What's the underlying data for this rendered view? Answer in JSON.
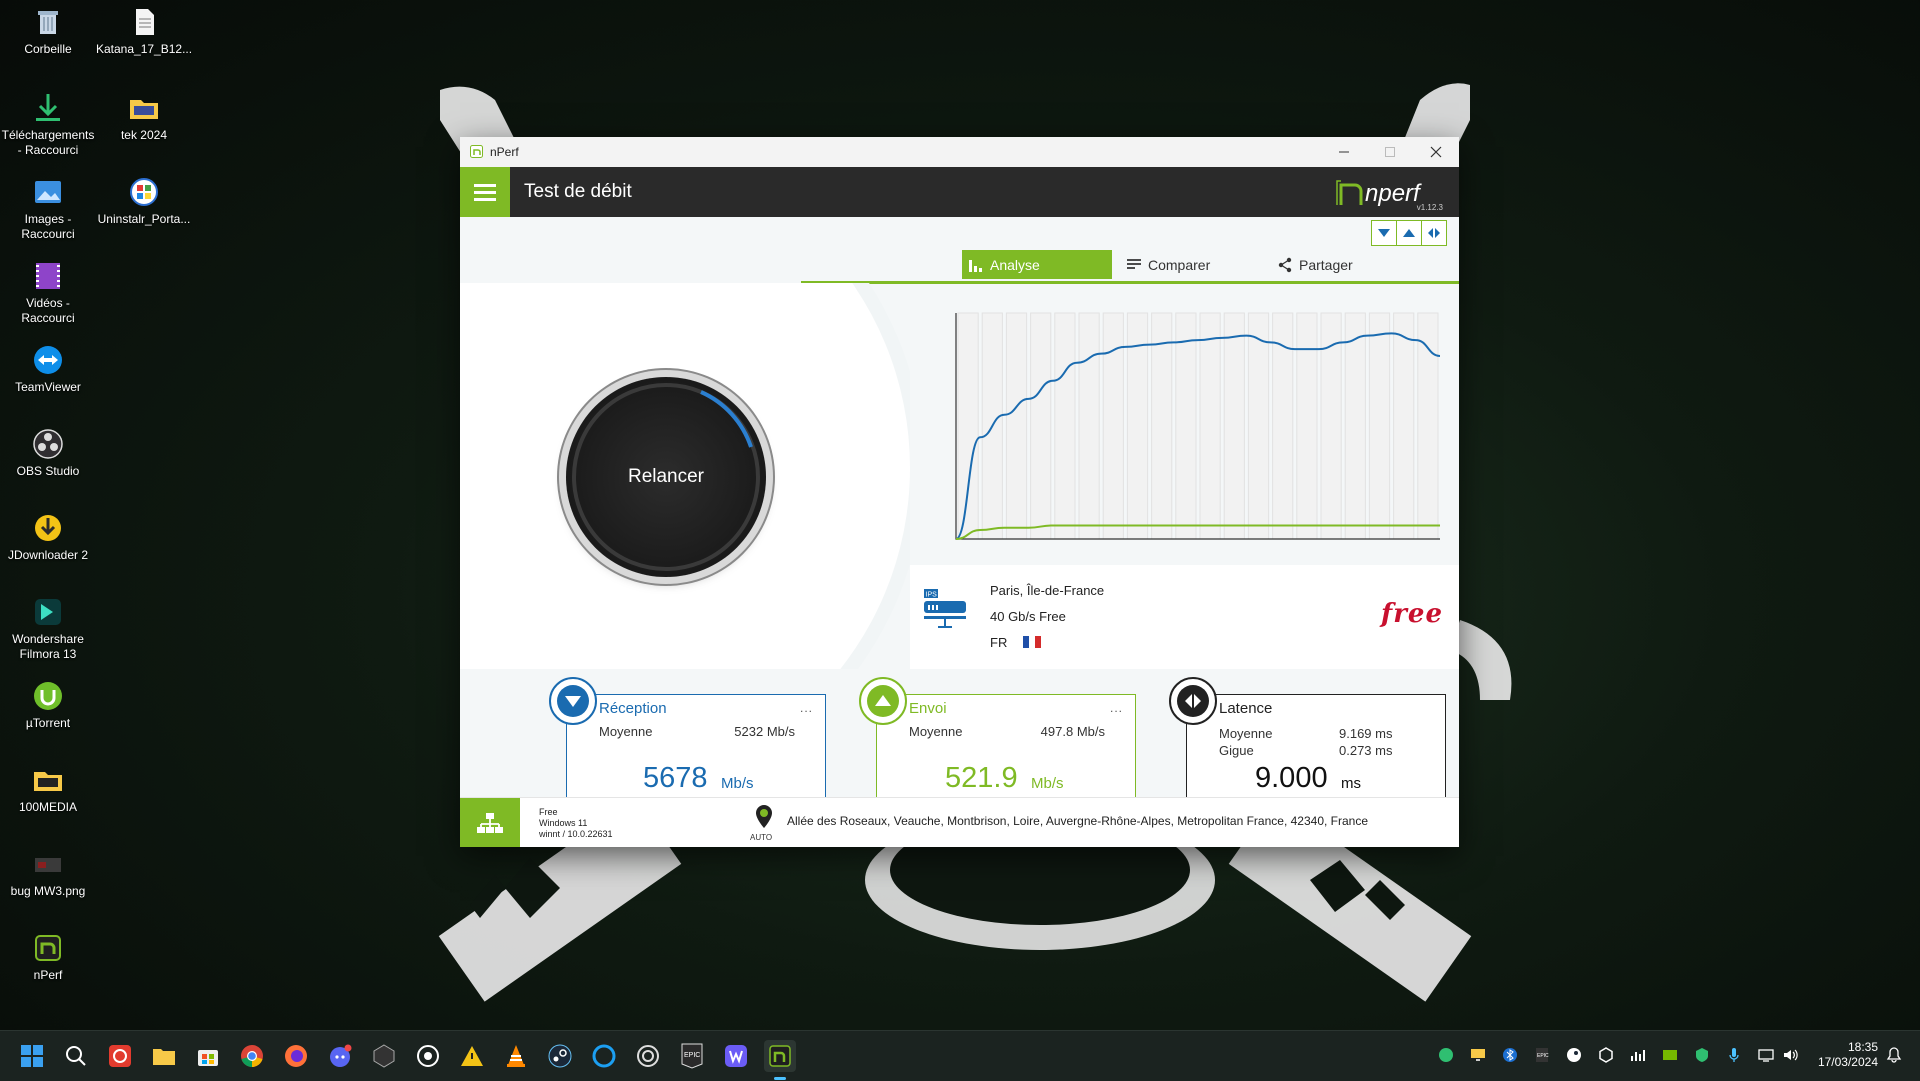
{
  "desktop": {
    "icons": [
      {
        "label": "Corbeille"
      },
      {
        "label": "Katana_17_B12..."
      },
      {
        "label": "Téléchargements - Raccourci"
      },
      {
        "label": "tek 2024"
      },
      {
        "label": "Images - Raccourci"
      },
      {
        "label": "Uninstalr_Porta..."
      },
      {
        "label": "Vidéos - Raccourci"
      },
      {
        "label": "TeamViewer"
      },
      {
        "label": "OBS Studio"
      },
      {
        "label": "JDownloader 2"
      },
      {
        "label": "Wondershare Filmora 13"
      },
      {
        "label": "µTorrent"
      },
      {
        "label": "100MEDIA"
      },
      {
        "label": "bug MW3.png"
      },
      {
        "label": "nPerf"
      }
    ]
  },
  "window": {
    "title": "nPerf",
    "app_title": "Test de débit",
    "logo_text": "nperf",
    "version": "v1.12.3",
    "tabs": [
      {
        "label": "Analyse",
        "icon": "bar-chart-icon"
      },
      {
        "label": "Comparer",
        "icon": "list-icon"
      },
      {
        "label": "Partager",
        "icon": "share-icon"
      }
    ],
    "restart_label": "Relancer",
    "server": {
      "location": "Paris, Île-de-France",
      "capacity": "40 Gb/s Free",
      "country": "FR",
      "isp_logo": "free"
    },
    "cards": {
      "download": {
        "title": "Réception",
        "more": "...",
        "avg_label": "Moyenne",
        "avg_value": "5232 Mb/s",
        "value": "5678",
        "unit": "Mb/s",
        "color": "#1a6bb0"
      },
      "upload": {
        "title": "Envoi",
        "more": "...",
        "avg_label": "Moyenne",
        "avg_value": "497.8 Mb/s",
        "value": "521.9",
        "unit": "Mb/s",
        "color": "#7fba25"
      },
      "latency": {
        "title": "Latence",
        "avg_label": "Moyenne",
        "avg_value": "9.169 ms",
        "jitter_label": "Gigue",
        "jitter_value": "0.273 ms",
        "value": "9.000",
        "unit": "ms",
        "color": "#222222"
      }
    },
    "footer": {
      "isp": "Free",
      "os": "Windows 11",
      "build": "winnt / 10.0.22631",
      "auto_label": "AUTO",
      "address": "Allée des Roseaux, Veauche, Montbrison, Loire, Auvergne-Rhône-Alpes, Metropolitan France, 42340, France"
    }
  },
  "chart_data": {
    "type": "line",
    "x": [
      0,
      1,
      2,
      3,
      4,
      5,
      6,
      7,
      8,
      9,
      10,
      11,
      12,
      13,
      14,
      15,
      16,
      17,
      18,
      19,
      20
    ],
    "series": [
      {
        "values": [
          0,
          45,
          55,
          62,
          70,
          78,
          82,
          85,
          86,
          87,
          88,
          89,
          90,
          87,
          84,
          84,
          87,
          90,
          91,
          88,
          81
        ],
        "color": "#1a6bb0"
      },
      {
        "values": [
          0,
          4,
          5,
          5,
          6,
          6,
          6,
          6,
          6,
          6,
          6,
          6,
          6,
          6,
          6,
          6,
          6,
          6,
          6,
          6,
          6
        ],
        "color": "#7fba25"
      }
    ],
    "bars": 20,
    "ylim": [
      0,
      100
    ]
  },
  "taskbar": {
    "time": "18:35",
    "date": "17/03/2024"
  }
}
